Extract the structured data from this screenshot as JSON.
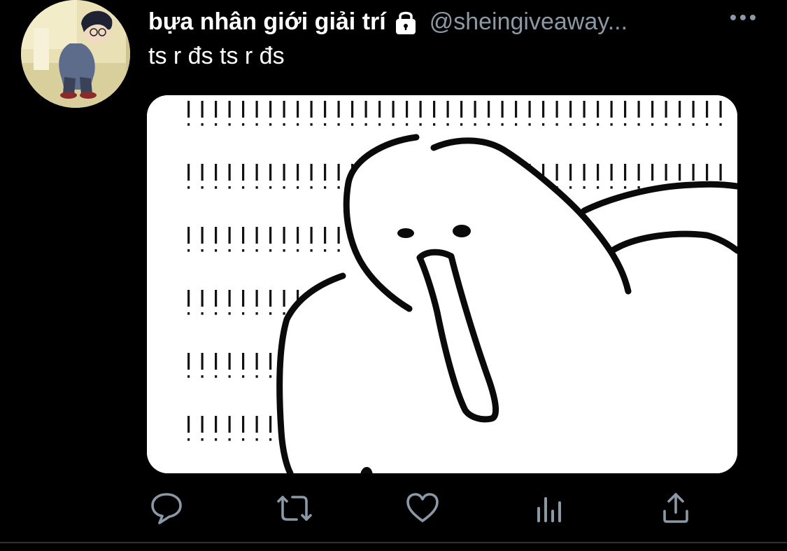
{
  "tweet": {
    "display_name": "bựa nhân giới giải trí",
    "handle": "@sheingiveaway...",
    "text": "ts r đs ts r đs"
  },
  "icons": {
    "avatar": "avatar-cartoon-boy",
    "protected": "lock-icon",
    "more": "more-horizontal-icon",
    "reply": "comment-bubble-icon",
    "retweet": "retweet-icon",
    "like": "heart-icon",
    "analytics": "bar-chart-icon",
    "share": "share-upload-icon"
  },
  "colors": {
    "background": "#000000",
    "text_primary": "#ffffff",
    "text_secondary": "#8b98a5",
    "icon": "#8b98a5"
  }
}
